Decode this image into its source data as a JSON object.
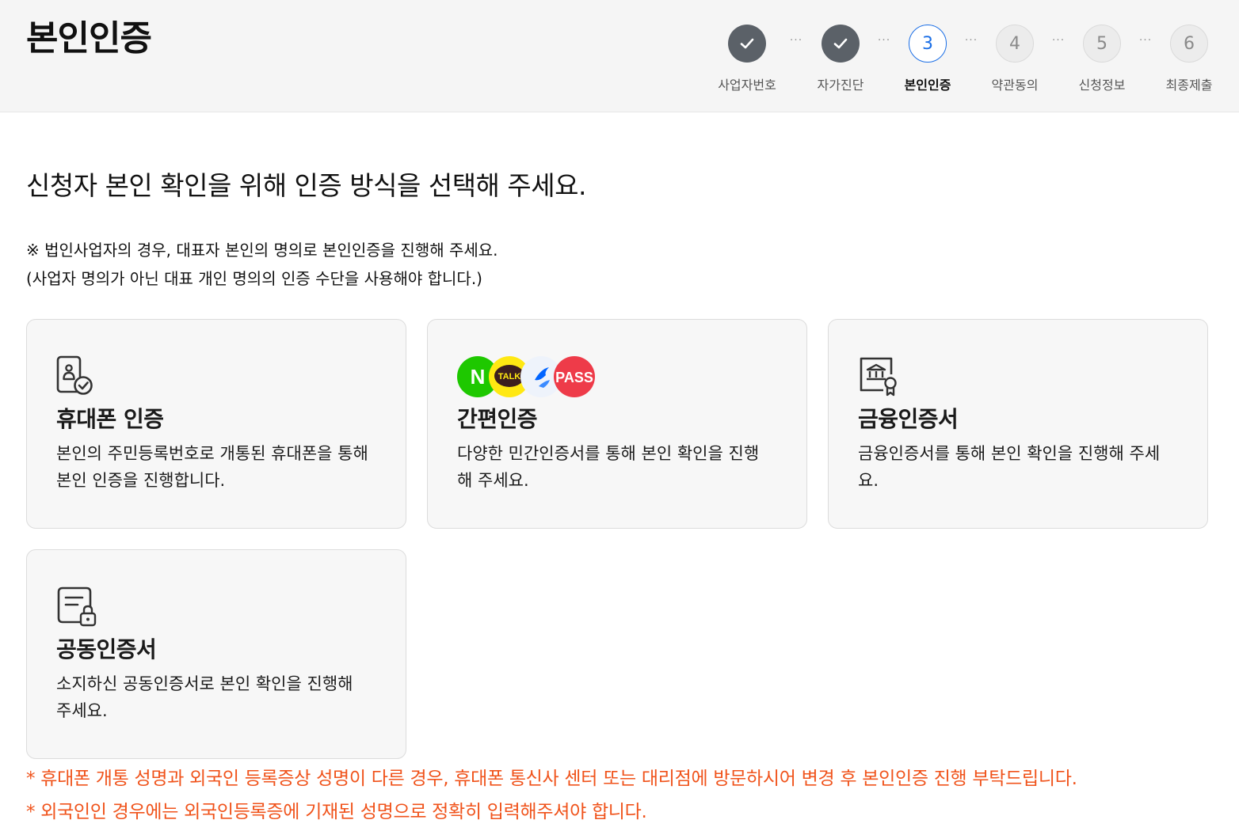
{
  "header": {
    "title": "본인인증"
  },
  "stepper": {
    "steps": [
      {
        "label": "사업자번호",
        "number": "",
        "status": "done"
      },
      {
        "label": "자가진단",
        "number": "",
        "status": "done"
      },
      {
        "label": "본인인증",
        "number": "3",
        "status": "active"
      },
      {
        "label": "약관동의",
        "number": "4",
        "status": "todo"
      },
      {
        "label": "신청정보",
        "number": "5",
        "status": "todo"
      },
      {
        "label": "최종제출",
        "number": "6",
        "status": "todo"
      }
    ],
    "separator": "···"
  },
  "main": {
    "heading": "신청자 본인 확인을 위해 인증 방식을 선택해 주세요.",
    "notice_line1": "※ 법인사업자의 경우, 대표자 본인의 명의로 본인인증을 진행해 주세요.",
    "notice_line2": "(사업자 명의가 아닌 대표 개인 명의의 인증 수단을 사용해야 합니다.)"
  },
  "cards": [
    {
      "title": "휴대폰 인증",
      "desc": "본인의 주민등록번호로 개통된 휴대폰을 통해 본인 인증을 진행합니다.",
      "icon": "phone-check-icon"
    },
    {
      "title": "간편인증",
      "desc": "다양한 민간인증서를 통해 본인 확인을 진행해 주세요.",
      "icon": "simple-auth-logos",
      "logos": [
        "N",
        "TALK",
        "PASS"
      ]
    },
    {
      "title": "금융인증서",
      "desc": "금융인증서를 통해 본인 확인을 진행해 주세요.",
      "icon": "bank-certificate-icon"
    },
    {
      "title": "공동인증서",
      "desc": "소지하신 공동인증서로 본인 확인을 진행해 주세요.",
      "icon": "document-lock-icon"
    }
  ],
  "warnings": [
    "* 휴대폰 개통 성명과 외국인 등록증상 성명이 다른 경우, 휴대폰 통신사 센터 또는 대리점에 방문하시어 변경 후 본인인증 진행 부탁드립니다.",
    "* 외국인인 경우에는 외국인등록증에 기재된 성명으로 정확히 입력해주셔야 합니다."
  ],
  "colors": {
    "accent": "#1a6ee6",
    "done": "#5b6168",
    "warning": "#f0531b",
    "naver": "#1ec800",
    "kakao": "#ffe812",
    "toss": "#0064ff",
    "pass": "#ee3b49"
  }
}
